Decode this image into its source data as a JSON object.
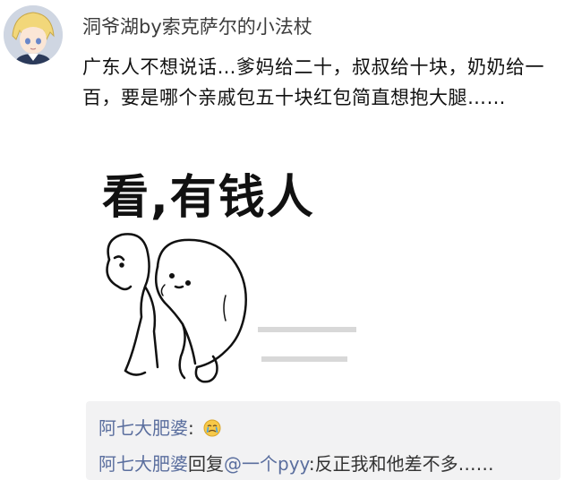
{
  "post": {
    "username": "洞爷湖by索克萨尔的小法杖",
    "text": "广东人不想说话…爹妈给二十，叔叔给十块，奶奶给一百，要是哪个亲戚包五十块红包简直想抱大腿……",
    "meme_caption": "看,有钱人"
  },
  "replies": [
    {
      "name": "阿七大肥婆",
      "separator": ":",
      "emoji": "crying-face-icon"
    },
    {
      "name": "阿七大肥婆",
      "verb": "回复",
      "mention": "@一个pyy",
      "separator": ":",
      "text": "反正我和他差不多……"
    }
  ]
}
